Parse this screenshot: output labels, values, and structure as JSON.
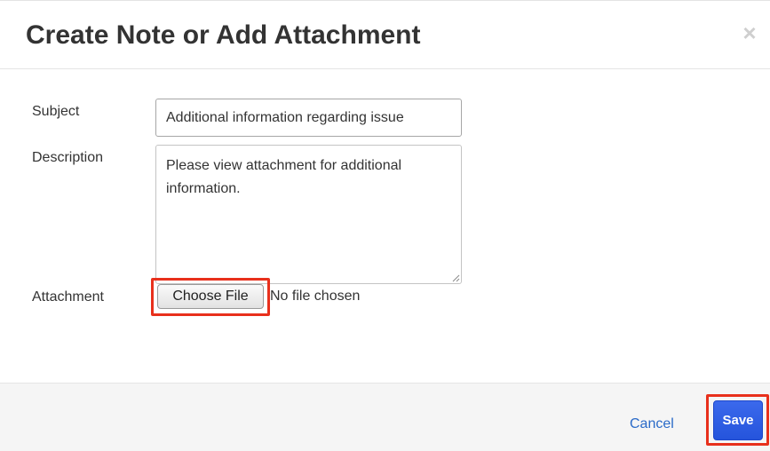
{
  "dialog": {
    "title": "Create Note or Add Attachment",
    "close_glyph": "×"
  },
  "form": {
    "subject_label": "Subject",
    "subject_value": "Additional information regarding issue",
    "description_label": "Description",
    "description_value": "Please view attachment for additional information.",
    "attachment_label": "Attachment",
    "choose_file_label": "Choose File",
    "file_status": "No file chosen"
  },
  "footer": {
    "cancel_label": "Cancel",
    "save_label": "Save"
  },
  "icons": {
    "close": "close-icon",
    "resize": "resize-grip-icon"
  },
  "colors": {
    "primary": "#2554dc",
    "link": "#2a6ac8",
    "highlight": "#e8301c"
  }
}
